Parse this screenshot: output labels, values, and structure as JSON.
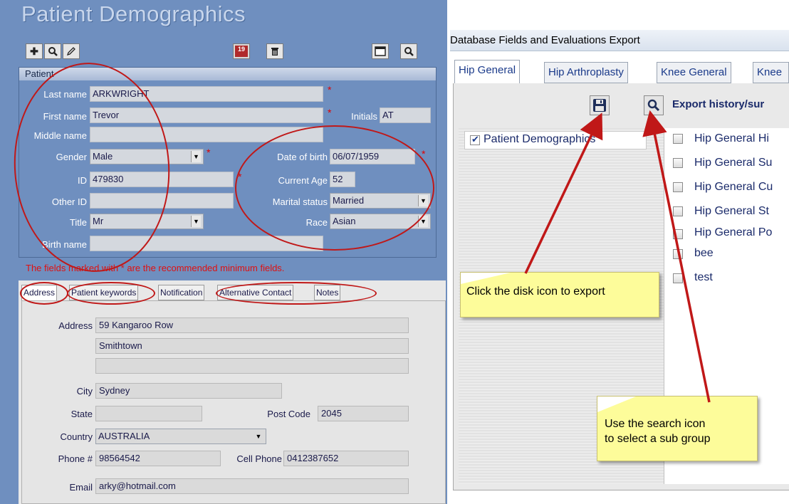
{
  "left_window": {
    "title": "Patient Demographics",
    "group_label": "Patient",
    "required_note": "The fields marked with * are the recommended minimum  fields.",
    "toolbar": {
      "badge_number": "19"
    },
    "fields": {
      "last_name": {
        "label": "Last name",
        "value": "ARKWRIGHT"
      },
      "first_name": {
        "label": "First name",
        "value": "Trevor"
      },
      "initials": {
        "label": "Initials",
        "value": "AT"
      },
      "middle_name": {
        "label": "Middle name",
        "value": ""
      },
      "gender": {
        "label": "Gender",
        "value": "Male"
      },
      "date_of_birth": {
        "label": "Date of birth",
        "value": "06/07/1959"
      },
      "id": {
        "label": "ID",
        "value": "479830"
      },
      "current_age": {
        "label": "Current Age",
        "value": "52"
      },
      "other_id": {
        "label": "Other ID",
        "value": ""
      },
      "marital_status": {
        "label": "Marital status",
        "value": "Married"
      },
      "title": {
        "label": "Title",
        "value": "Mr"
      },
      "race": {
        "label": "Race",
        "value": "Asian"
      },
      "birth_name": {
        "label": "Birth name",
        "value": ""
      }
    },
    "star": "*",
    "tabs": [
      "Address",
      "Patient keywords",
      "Notification",
      "Alternative Contact",
      "Notes"
    ],
    "address": {
      "address_label": "Address",
      "address_line1": "59 Kangaroo Row",
      "address_line2": "Smithtown",
      "address_line3": "",
      "city_label": "City",
      "city": "Sydney",
      "state_label": "State",
      "state": "",
      "postcode_label": "Post Code",
      "postcode": "2045",
      "country_label": "Country",
      "country": "AUSTRALIA",
      "phone_label": "Phone #",
      "phone": "98564542",
      "cell_label": "Cell Phone",
      "cell": "0412387652",
      "email_label": "Email",
      "email": "arky@hotmail.com"
    }
  },
  "right_window": {
    "title": "Database Fields and Evaluations Export",
    "tabs": [
      "Hip General",
      "Hip Arthroplasty",
      "Knee General",
      "Knee"
    ],
    "export_heading": "Export history/sur",
    "patient_demographics": "Patient Demographics",
    "items": [
      "Hip General Hi",
      "Hip General Su",
      "Hip General Cu",
      "Hip General St",
      "Hip General Po",
      "bee",
      "test"
    ],
    "note_export": "Click the disk icon  to export",
    "note_search_line1": "Use the search icon",
    "note_search_line2": "to select a sub group"
  }
}
